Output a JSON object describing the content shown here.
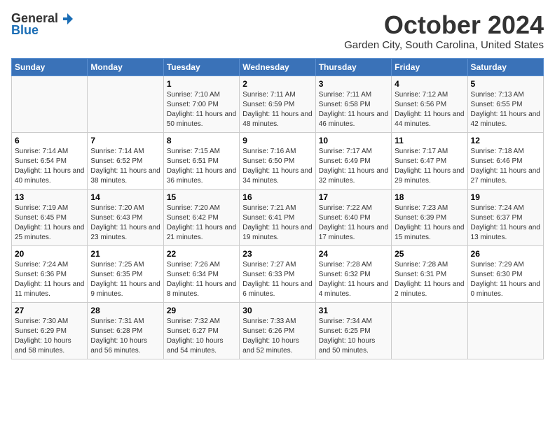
{
  "header": {
    "logo_general": "General",
    "logo_blue": "Blue",
    "month_title": "October 2024",
    "subtitle": "Garden City, South Carolina, United States"
  },
  "weekdays": [
    "Sunday",
    "Monday",
    "Tuesday",
    "Wednesday",
    "Thursday",
    "Friday",
    "Saturday"
  ],
  "weeks": [
    [
      {
        "day": "",
        "sunrise": "",
        "sunset": "",
        "daylight": ""
      },
      {
        "day": "",
        "sunrise": "",
        "sunset": "",
        "daylight": ""
      },
      {
        "day": "1",
        "sunrise": "Sunrise: 7:10 AM",
        "sunset": "Sunset: 7:00 PM",
        "daylight": "Daylight: 11 hours and 50 minutes."
      },
      {
        "day": "2",
        "sunrise": "Sunrise: 7:11 AM",
        "sunset": "Sunset: 6:59 PM",
        "daylight": "Daylight: 11 hours and 48 minutes."
      },
      {
        "day": "3",
        "sunrise": "Sunrise: 7:11 AM",
        "sunset": "Sunset: 6:58 PM",
        "daylight": "Daylight: 11 hours and 46 minutes."
      },
      {
        "day": "4",
        "sunrise": "Sunrise: 7:12 AM",
        "sunset": "Sunset: 6:56 PM",
        "daylight": "Daylight: 11 hours and 44 minutes."
      },
      {
        "day": "5",
        "sunrise": "Sunrise: 7:13 AM",
        "sunset": "Sunset: 6:55 PM",
        "daylight": "Daylight: 11 hours and 42 minutes."
      }
    ],
    [
      {
        "day": "6",
        "sunrise": "Sunrise: 7:14 AM",
        "sunset": "Sunset: 6:54 PM",
        "daylight": "Daylight: 11 hours and 40 minutes."
      },
      {
        "day": "7",
        "sunrise": "Sunrise: 7:14 AM",
        "sunset": "Sunset: 6:52 PM",
        "daylight": "Daylight: 11 hours and 38 minutes."
      },
      {
        "day": "8",
        "sunrise": "Sunrise: 7:15 AM",
        "sunset": "Sunset: 6:51 PM",
        "daylight": "Daylight: 11 hours and 36 minutes."
      },
      {
        "day": "9",
        "sunrise": "Sunrise: 7:16 AM",
        "sunset": "Sunset: 6:50 PM",
        "daylight": "Daylight: 11 hours and 34 minutes."
      },
      {
        "day": "10",
        "sunrise": "Sunrise: 7:17 AM",
        "sunset": "Sunset: 6:49 PM",
        "daylight": "Daylight: 11 hours and 32 minutes."
      },
      {
        "day": "11",
        "sunrise": "Sunrise: 7:17 AM",
        "sunset": "Sunset: 6:47 PM",
        "daylight": "Daylight: 11 hours and 29 minutes."
      },
      {
        "day": "12",
        "sunrise": "Sunrise: 7:18 AM",
        "sunset": "Sunset: 6:46 PM",
        "daylight": "Daylight: 11 hours and 27 minutes."
      }
    ],
    [
      {
        "day": "13",
        "sunrise": "Sunrise: 7:19 AM",
        "sunset": "Sunset: 6:45 PM",
        "daylight": "Daylight: 11 hours and 25 minutes."
      },
      {
        "day": "14",
        "sunrise": "Sunrise: 7:20 AM",
        "sunset": "Sunset: 6:43 PM",
        "daylight": "Daylight: 11 hours and 23 minutes."
      },
      {
        "day": "15",
        "sunrise": "Sunrise: 7:20 AM",
        "sunset": "Sunset: 6:42 PM",
        "daylight": "Daylight: 11 hours and 21 minutes."
      },
      {
        "day": "16",
        "sunrise": "Sunrise: 7:21 AM",
        "sunset": "Sunset: 6:41 PM",
        "daylight": "Daylight: 11 hours and 19 minutes."
      },
      {
        "day": "17",
        "sunrise": "Sunrise: 7:22 AM",
        "sunset": "Sunset: 6:40 PM",
        "daylight": "Daylight: 11 hours and 17 minutes."
      },
      {
        "day": "18",
        "sunrise": "Sunrise: 7:23 AM",
        "sunset": "Sunset: 6:39 PM",
        "daylight": "Daylight: 11 hours and 15 minutes."
      },
      {
        "day": "19",
        "sunrise": "Sunrise: 7:24 AM",
        "sunset": "Sunset: 6:37 PM",
        "daylight": "Daylight: 11 hours and 13 minutes."
      }
    ],
    [
      {
        "day": "20",
        "sunrise": "Sunrise: 7:24 AM",
        "sunset": "Sunset: 6:36 PM",
        "daylight": "Daylight: 11 hours and 11 minutes."
      },
      {
        "day": "21",
        "sunrise": "Sunrise: 7:25 AM",
        "sunset": "Sunset: 6:35 PM",
        "daylight": "Daylight: 11 hours and 9 minutes."
      },
      {
        "day": "22",
        "sunrise": "Sunrise: 7:26 AM",
        "sunset": "Sunset: 6:34 PM",
        "daylight": "Daylight: 11 hours and 8 minutes."
      },
      {
        "day": "23",
        "sunrise": "Sunrise: 7:27 AM",
        "sunset": "Sunset: 6:33 PM",
        "daylight": "Daylight: 11 hours and 6 minutes."
      },
      {
        "day": "24",
        "sunrise": "Sunrise: 7:28 AM",
        "sunset": "Sunset: 6:32 PM",
        "daylight": "Daylight: 11 hours and 4 minutes."
      },
      {
        "day": "25",
        "sunrise": "Sunrise: 7:28 AM",
        "sunset": "Sunset: 6:31 PM",
        "daylight": "Daylight: 11 hours and 2 minutes."
      },
      {
        "day": "26",
        "sunrise": "Sunrise: 7:29 AM",
        "sunset": "Sunset: 6:30 PM",
        "daylight": "Daylight: 11 hours and 0 minutes."
      }
    ],
    [
      {
        "day": "27",
        "sunrise": "Sunrise: 7:30 AM",
        "sunset": "Sunset: 6:29 PM",
        "daylight": "Daylight: 10 hours and 58 minutes."
      },
      {
        "day": "28",
        "sunrise": "Sunrise: 7:31 AM",
        "sunset": "Sunset: 6:28 PM",
        "daylight": "Daylight: 10 hours and 56 minutes."
      },
      {
        "day": "29",
        "sunrise": "Sunrise: 7:32 AM",
        "sunset": "Sunset: 6:27 PM",
        "daylight": "Daylight: 10 hours and 54 minutes."
      },
      {
        "day": "30",
        "sunrise": "Sunrise: 7:33 AM",
        "sunset": "Sunset: 6:26 PM",
        "daylight": "Daylight: 10 hours and 52 minutes."
      },
      {
        "day": "31",
        "sunrise": "Sunrise: 7:34 AM",
        "sunset": "Sunset: 6:25 PM",
        "daylight": "Daylight: 10 hours and 50 minutes."
      },
      {
        "day": "",
        "sunrise": "",
        "sunset": "",
        "daylight": ""
      },
      {
        "day": "",
        "sunrise": "",
        "sunset": "",
        "daylight": ""
      }
    ]
  ]
}
